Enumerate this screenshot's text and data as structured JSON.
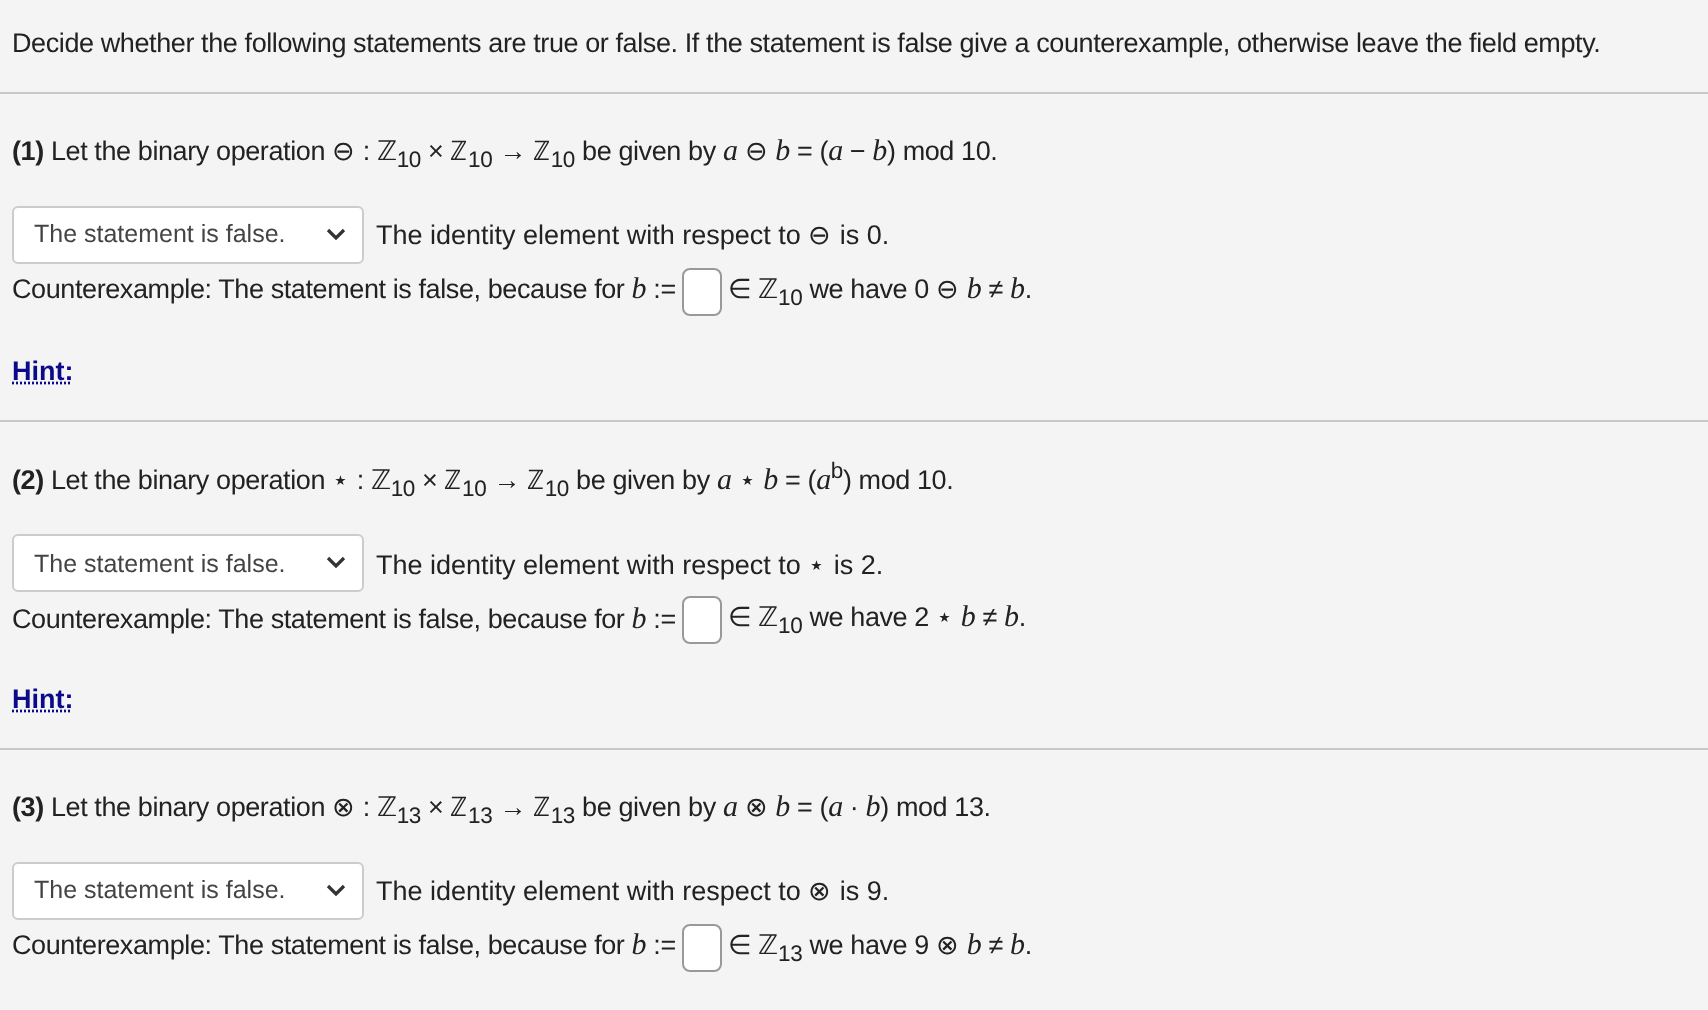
{
  "instructions": "Decide whether the following statements are true or false. If the statement is false give a counterexample, otherwise leave the field empty.",
  "problems": [
    {
      "number": "(1)",
      "statement": "Let the binary operation ⊖ : ℤ$_{10}$ × ℤ$_{10}$ → ℤ$_{10}$ be given by *a* ⊖ *b* = (*a* − *b*) mod 10.",
      "answer": "The statement is false.",
      "claim": "The identity element with respect to ⊖ is 0.",
      "counterexample_before": "Counterexample: The statement is false, because for *b* :=",
      "counterexample_after": "∈ ℤ$_{10}$ we have 0 ⊖ *b* ≠ *b*.",
      "hint": "Hint:"
    },
    {
      "number": "(2)",
      "statement": "Let the binary operation ⋆ : ℤ$_{10}$ × ℤ$_{10}$ → ℤ$_{10}$ be given by *a* ⋆ *b* = (*a*$^{b}$) mod 10.",
      "answer": "The statement is false.",
      "claim": "The identity element with respect to ⋆ is 2.",
      "counterexample_before": "Counterexample: The statement is false, because for *b* :=",
      "counterexample_after": "∈ ℤ$_{10}$ we have 2 ⋆ *b* ≠ *b*.",
      "hint": "Hint:"
    },
    {
      "number": "(3)",
      "statement": "Let the binary operation ⊗ : ℤ$_{13}$ × ℤ$_{13}$ → ℤ$_{13}$ be given by *a* ⊗ *b* = (*a* · *b*) mod 13.",
      "answer": "The statement is false.",
      "claim": "The identity element with respect to ⊗ is 9.",
      "counterexample_before": "Counterexample: The statement is false, because for *b* :=",
      "counterexample_after": "∈ ℤ$_{13}$ we have 9 ⊗ *b* ≠ *b*."
    }
  ]
}
